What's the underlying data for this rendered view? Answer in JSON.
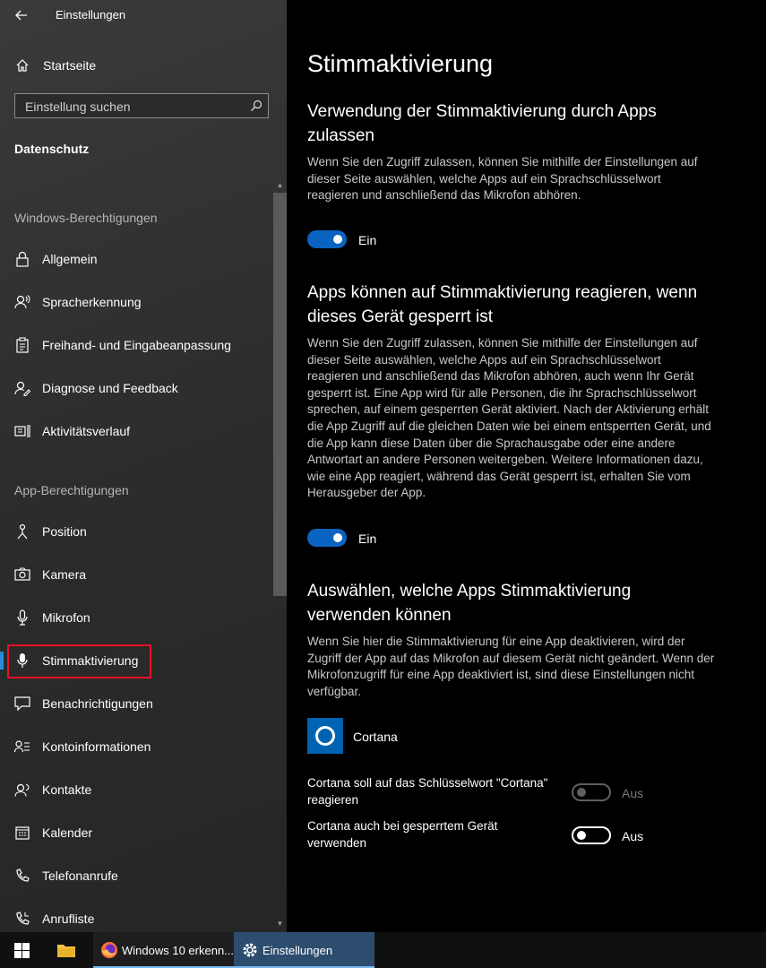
{
  "window": {
    "title": "Einstellungen",
    "back_icon": "back-arrow-icon"
  },
  "sidebar": {
    "home_label": "Startseite",
    "search_placeholder": "Einstellung suchen",
    "section_title": "Datenschutz",
    "group_windows": "Windows-Berechtigungen",
    "windows_items": [
      {
        "label": "Allgemein",
        "icon": "lock-icon"
      },
      {
        "label": "Spracherkennung",
        "icon": "speech-icon"
      },
      {
        "label": "Freihand- und Eingabeanpassung",
        "icon": "clipboard-icon"
      },
      {
        "label": "Diagnose und Feedback",
        "icon": "feedback-icon"
      },
      {
        "label": "Aktivitätsverlauf",
        "icon": "timeline-icon"
      }
    ],
    "group_apps": "App-Berechtigungen",
    "app_items": [
      {
        "label": "Position",
        "icon": "location-icon"
      },
      {
        "label": "Kamera",
        "icon": "camera-icon"
      },
      {
        "label": "Mikrofon",
        "icon": "microphone-icon"
      },
      {
        "label": "Stimmaktivierung",
        "icon": "voice-activation-icon",
        "selected": true
      },
      {
        "label": "Benachrichtigungen",
        "icon": "notification-icon"
      },
      {
        "label": "Kontoinformationen",
        "icon": "account-info-icon"
      },
      {
        "label": "Kontakte",
        "icon": "contacts-icon"
      },
      {
        "label": "Kalender",
        "icon": "calendar-icon"
      },
      {
        "label": "Telefonanrufe",
        "icon": "phone-icon"
      },
      {
        "label": "Anrufliste",
        "icon": "call-history-icon"
      }
    ]
  },
  "main": {
    "page_title": "Stimmaktivierung",
    "section1": {
      "title": "Verwendung der Stimmaktivierung durch Apps zulassen",
      "description": "Wenn Sie den Zugriff zulassen, können Sie mithilfe der Einstellungen auf dieser Seite auswählen, welche Apps auf ein Sprachschlüsselwort reagieren und anschließend das Mikrofon abhören.",
      "toggle_state": "Ein"
    },
    "section2": {
      "title": "Apps können auf Stimmaktivierung reagieren, wenn dieses Gerät gesperrt ist",
      "description": "Wenn Sie den Zugriff zulassen, können Sie mithilfe der Einstellungen auf dieser Seite auswählen, welche Apps auf ein Sprachschlüsselwort reagieren und anschließend das Mikrofon abhören, auch wenn Ihr Gerät gesperrt ist. Eine App wird für alle Personen, die ihr Sprachschlüsselwort sprechen, auf einem gesperrten Gerät aktiviert. Nach der Aktivierung erhält die App Zugriff auf die gleichen Daten wie bei einem entsperrten Gerät, und die App kann diese Daten über die Sprachausgabe oder eine andere Antwortart an andere Personen weitergeben. Weitere Informationen dazu, wie eine App reagiert, während das Gerät gesperrt ist, erhalten Sie vom Herausgeber der App.",
      "toggle_state": "Ein"
    },
    "section3": {
      "title": "Auswählen, welche Apps Stimmaktivierung verwenden können",
      "description": "Wenn Sie hier die Stimmaktivierung für eine App deaktivieren, wird der Zugriff der App auf das Mikrofon auf diesem Gerät nicht geändert. Wenn der Mikrofonzugriff für eine App deaktiviert ist, sind diese Einstellungen nicht verfügbar.",
      "app_name": "Cortana",
      "option1_label": "Cortana soll auf das Schlüsselwort \"Cortana\" reagieren",
      "option1_state": "Aus",
      "option2_label": "Cortana auch bei gesperrtem Gerät verwenden",
      "option2_state": "Aus"
    }
  },
  "taskbar": {
    "task_firefox": "Windows 10 erkenn...",
    "task_settings": "Einstellungen"
  },
  "colors": {
    "accent": "#0a63c0",
    "cortana_tile": "#0063b1",
    "highlight": "#e81123"
  }
}
